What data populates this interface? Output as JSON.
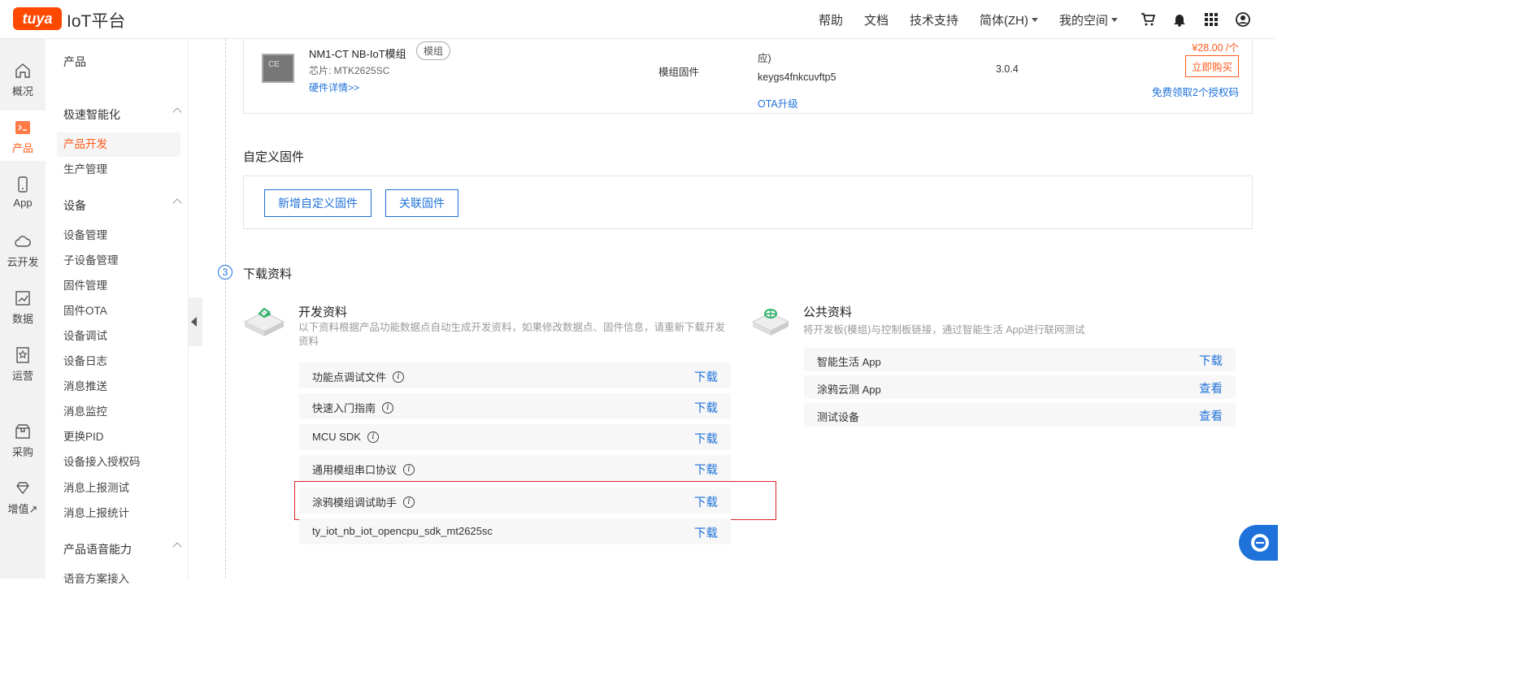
{
  "brand": {
    "logo_text": "tuya",
    "title": "IoT平台"
  },
  "topnav": {
    "help": "帮助",
    "docs": "文档",
    "support": "技术支持",
    "language": "简体(ZH)",
    "my_space": "我的空间"
  },
  "rail": [
    {
      "label": "概况",
      "icon": "home-icon"
    },
    {
      "label": "产品",
      "icon": "terminal-icon"
    },
    {
      "label": "App",
      "icon": "phone-icon"
    },
    {
      "label": "云开发",
      "icon": "cloud-icon"
    },
    {
      "label": "数据",
      "icon": "chart-icon"
    },
    {
      "label": "运营",
      "icon": "star-doc-icon"
    },
    {
      "label": "采购",
      "icon": "box-icon"
    },
    {
      "label": "增值↗",
      "icon": "diamond-icon"
    }
  ],
  "sidebar": {
    "title": "产品",
    "groups": {
      "speed": "极速智能化",
      "device": "设备",
      "voice": "产品语音能力"
    },
    "items": [
      "产品开发",
      "生产管理",
      "设备管理",
      "子设备管理",
      "固件管理",
      "固件OTA",
      "设备调试",
      "设备日志",
      "消息推送",
      "消息监控",
      "更换PID",
      "设备接入授权码",
      "消息上报测试",
      "消息上报统计",
      "语音方案接入"
    ]
  },
  "module": {
    "name": "NM1-CT NB-IoT模组",
    "tag": "模组",
    "chip": "芯片: MTK2625SC",
    "hw_link": "硬件详情>>",
    "type": "模组固件",
    "note": "应)",
    "key": "keygs4fnkcuvftp5",
    "ota": "OTA升级",
    "version": "3.0.4",
    "price": "¥28.00 /个",
    "buy": "立即购买",
    "free": "免费领取2个授权码"
  },
  "custom_firmware": {
    "title": "自定义固件",
    "add": "新增自定义固件",
    "link": "关联固件"
  },
  "download": {
    "step": "3",
    "title": "下载资料",
    "dev": {
      "title": "开发资料",
      "desc": "以下资料根据产品功能数据点自动生成开发资料，如果修改数据点、固件信息，请重新下载开发资料",
      "rows": [
        {
          "label": "功能点调试文件",
          "action": "下载"
        },
        {
          "label": "快速入门指南",
          "action": "下载"
        },
        {
          "label": "MCU SDK",
          "action": "下载"
        },
        {
          "label": "通用模组串口协议",
          "action": "下载"
        },
        {
          "label": "涂鸦模组调试助手",
          "action": "下载"
        },
        {
          "label": "ty_iot_nb_iot_opencpu_sdk_mt2625sc",
          "action": "下载"
        }
      ]
    },
    "pub": {
      "title": "公共资料",
      "desc": "将开发板(模组)与控制板链接，通过智能生活 App进行联网测试",
      "rows": [
        {
          "label": "智能生活 App",
          "action": "下载"
        },
        {
          "label": "涂鸦云测 App",
          "action": "查看"
        },
        {
          "label": "测试设备",
          "action": "查看"
        }
      ]
    }
  },
  "colors": {
    "brand": "#ff4800",
    "accent": "#ff5b1a",
    "link": "#1e72d9",
    "highlight": "#d9232b"
  }
}
